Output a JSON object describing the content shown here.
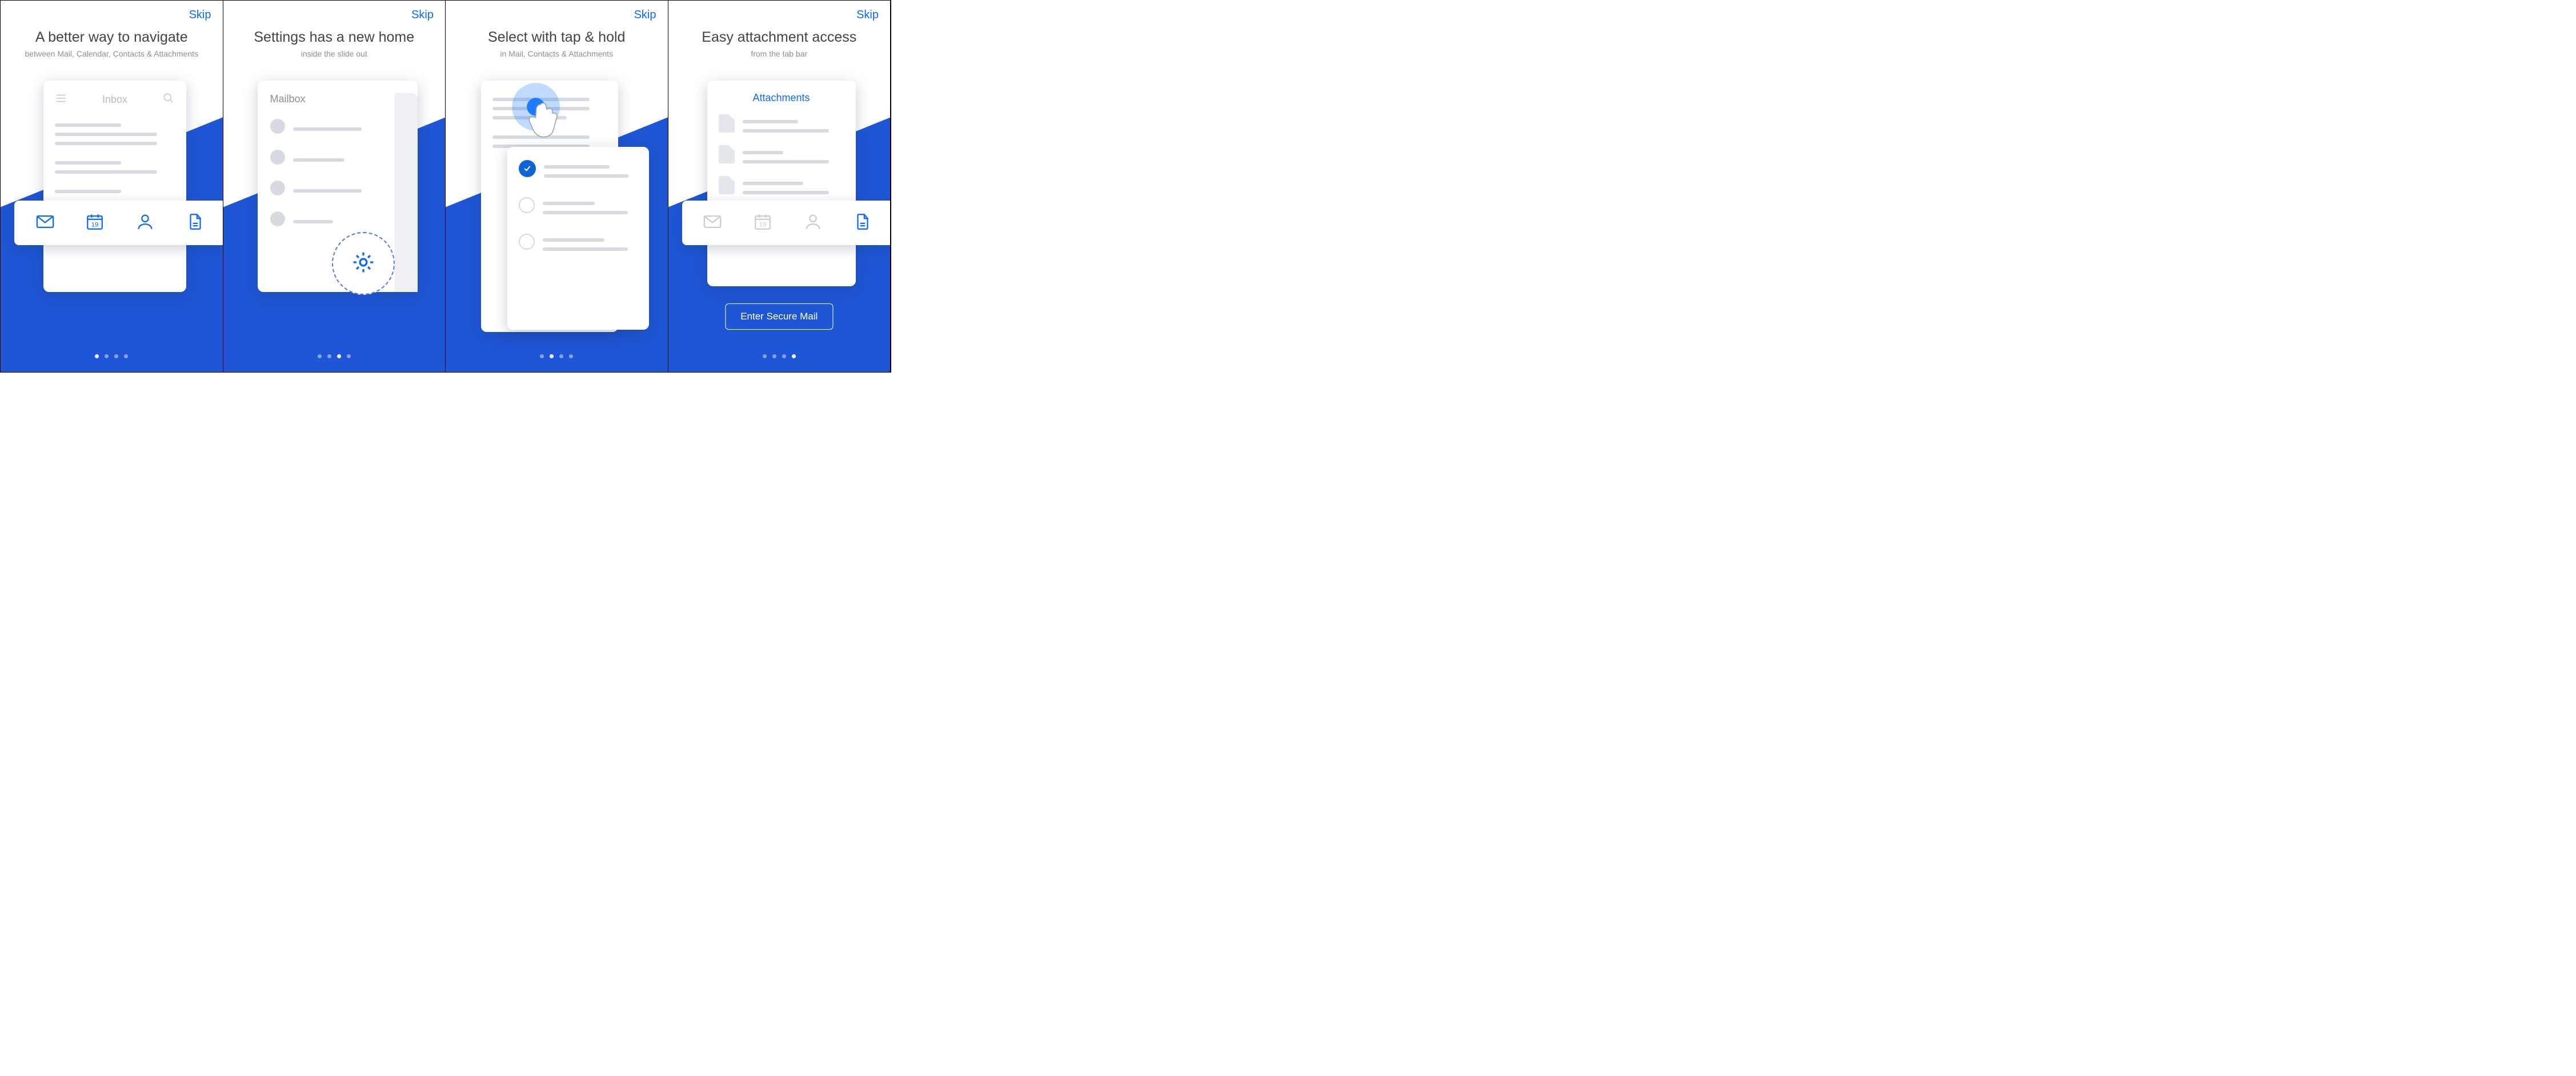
{
  "skip_label": "Skip",
  "screens": [
    {
      "title": "A better way to navigate",
      "subtitle": "between Mail, Calendar, Contacts & Attachments",
      "inbox_label": "Inbox",
      "active_dot": 0,
      "tabs": [
        "mail",
        "calendar",
        "contacts",
        "attachments"
      ],
      "calendar_day": "19"
    },
    {
      "title": "Settings has a new home",
      "subtitle": "inside the slide out",
      "mailbox_label": "Mailbox",
      "active_dot": 2
    },
    {
      "title": "Select with tap & hold",
      "subtitle": "in Mail, Contacts & Attachments",
      "active_dot": 1
    },
    {
      "title": "Easy attachment access",
      "subtitle": "from the tab bar",
      "attachments_label": "Attachments",
      "enter_label": "Enter Secure Mail",
      "active_dot": 3,
      "calendar_day": "19"
    }
  ],
  "colors": {
    "accent": "#0b69ff",
    "bg_dark": "#1f56d6",
    "bg_light": "#6b95e6"
  }
}
